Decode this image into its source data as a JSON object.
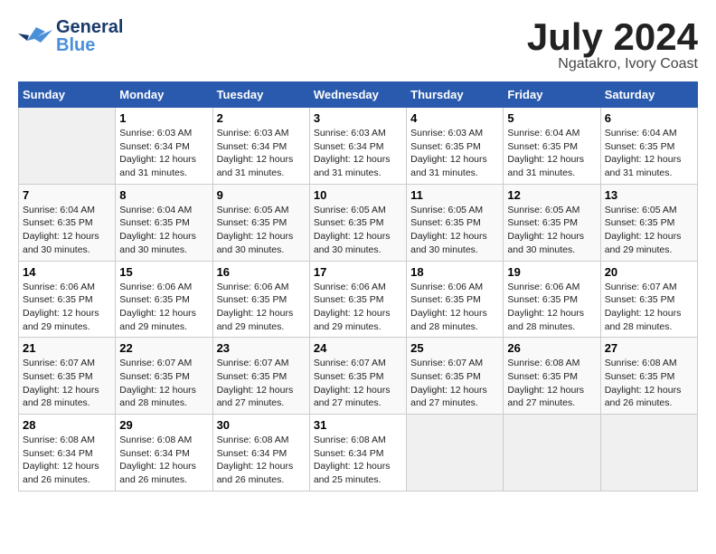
{
  "header": {
    "logo_general": "General",
    "logo_blue": "Blue",
    "month": "July 2024",
    "location": "Ngatakro, Ivory Coast"
  },
  "days_of_week": [
    "Sunday",
    "Monday",
    "Tuesday",
    "Wednesday",
    "Thursday",
    "Friday",
    "Saturday"
  ],
  "weeks": [
    [
      {
        "day": "",
        "info": ""
      },
      {
        "day": "1",
        "info": "Sunrise: 6:03 AM\nSunset: 6:34 PM\nDaylight: 12 hours\nand 31 minutes."
      },
      {
        "day": "2",
        "info": "Sunrise: 6:03 AM\nSunset: 6:34 PM\nDaylight: 12 hours\nand 31 minutes."
      },
      {
        "day": "3",
        "info": "Sunrise: 6:03 AM\nSunset: 6:34 PM\nDaylight: 12 hours\nand 31 minutes."
      },
      {
        "day": "4",
        "info": "Sunrise: 6:03 AM\nSunset: 6:35 PM\nDaylight: 12 hours\nand 31 minutes."
      },
      {
        "day": "5",
        "info": "Sunrise: 6:04 AM\nSunset: 6:35 PM\nDaylight: 12 hours\nand 31 minutes."
      },
      {
        "day": "6",
        "info": "Sunrise: 6:04 AM\nSunset: 6:35 PM\nDaylight: 12 hours\nand 31 minutes."
      }
    ],
    [
      {
        "day": "7",
        "info": "Sunrise: 6:04 AM\nSunset: 6:35 PM\nDaylight: 12 hours\nand 30 minutes."
      },
      {
        "day": "8",
        "info": "Sunrise: 6:04 AM\nSunset: 6:35 PM\nDaylight: 12 hours\nand 30 minutes."
      },
      {
        "day": "9",
        "info": "Sunrise: 6:05 AM\nSunset: 6:35 PM\nDaylight: 12 hours\nand 30 minutes."
      },
      {
        "day": "10",
        "info": "Sunrise: 6:05 AM\nSunset: 6:35 PM\nDaylight: 12 hours\nand 30 minutes."
      },
      {
        "day": "11",
        "info": "Sunrise: 6:05 AM\nSunset: 6:35 PM\nDaylight: 12 hours\nand 30 minutes."
      },
      {
        "day": "12",
        "info": "Sunrise: 6:05 AM\nSunset: 6:35 PM\nDaylight: 12 hours\nand 30 minutes."
      },
      {
        "day": "13",
        "info": "Sunrise: 6:05 AM\nSunset: 6:35 PM\nDaylight: 12 hours\nand 29 minutes."
      }
    ],
    [
      {
        "day": "14",
        "info": "Sunrise: 6:06 AM\nSunset: 6:35 PM\nDaylight: 12 hours\nand 29 minutes."
      },
      {
        "day": "15",
        "info": "Sunrise: 6:06 AM\nSunset: 6:35 PM\nDaylight: 12 hours\nand 29 minutes."
      },
      {
        "day": "16",
        "info": "Sunrise: 6:06 AM\nSunset: 6:35 PM\nDaylight: 12 hours\nand 29 minutes."
      },
      {
        "day": "17",
        "info": "Sunrise: 6:06 AM\nSunset: 6:35 PM\nDaylight: 12 hours\nand 29 minutes."
      },
      {
        "day": "18",
        "info": "Sunrise: 6:06 AM\nSunset: 6:35 PM\nDaylight: 12 hours\nand 28 minutes."
      },
      {
        "day": "19",
        "info": "Sunrise: 6:06 AM\nSunset: 6:35 PM\nDaylight: 12 hours\nand 28 minutes."
      },
      {
        "day": "20",
        "info": "Sunrise: 6:07 AM\nSunset: 6:35 PM\nDaylight: 12 hours\nand 28 minutes."
      }
    ],
    [
      {
        "day": "21",
        "info": "Sunrise: 6:07 AM\nSunset: 6:35 PM\nDaylight: 12 hours\nand 28 minutes."
      },
      {
        "day": "22",
        "info": "Sunrise: 6:07 AM\nSunset: 6:35 PM\nDaylight: 12 hours\nand 28 minutes."
      },
      {
        "day": "23",
        "info": "Sunrise: 6:07 AM\nSunset: 6:35 PM\nDaylight: 12 hours\nand 27 minutes."
      },
      {
        "day": "24",
        "info": "Sunrise: 6:07 AM\nSunset: 6:35 PM\nDaylight: 12 hours\nand 27 minutes."
      },
      {
        "day": "25",
        "info": "Sunrise: 6:07 AM\nSunset: 6:35 PM\nDaylight: 12 hours\nand 27 minutes."
      },
      {
        "day": "26",
        "info": "Sunrise: 6:08 AM\nSunset: 6:35 PM\nDaylight: 12 hours\nand 27 minutes."
      },
      {
        "day": "27",
        "info": "Sunrise: 6:08 AM\nSunset: 6:35 PM\nDaylight: 12 hours\nand 26 minutes."
      }
    ],
    [
      {
        "day": "28",
        "info": "Sunrise: 6:08 AM\nSunset: 6:34 PM\nDaylight: 12 hours\nand 26 minutes."
      },
      {
        "day": "29",
        "info": "Sunrise: 6:08 AM\nSunset: 6:34 PM\nDaylight: 12 hours\nand 26 minutes."
      },
      {
        "day": "30",
        "info": "Sunrise: 6:08 AM\nSunset: 6:34 PM\nDaylight: 12 hours\nand 26 minutes."
      },
      {
        "day": "31",
        "info": "Sunrise: 6:08 AM\nSunset: 6:34 PM\nDaylight: 12 hours\nand 25 minutes."
      },
      {
        "day": "",
        "info": ""
      },
      {
        "day": "",
        "info": ""
      },
      {
        "day": "",
        "info": ""
      }
    ]
  ]
}
